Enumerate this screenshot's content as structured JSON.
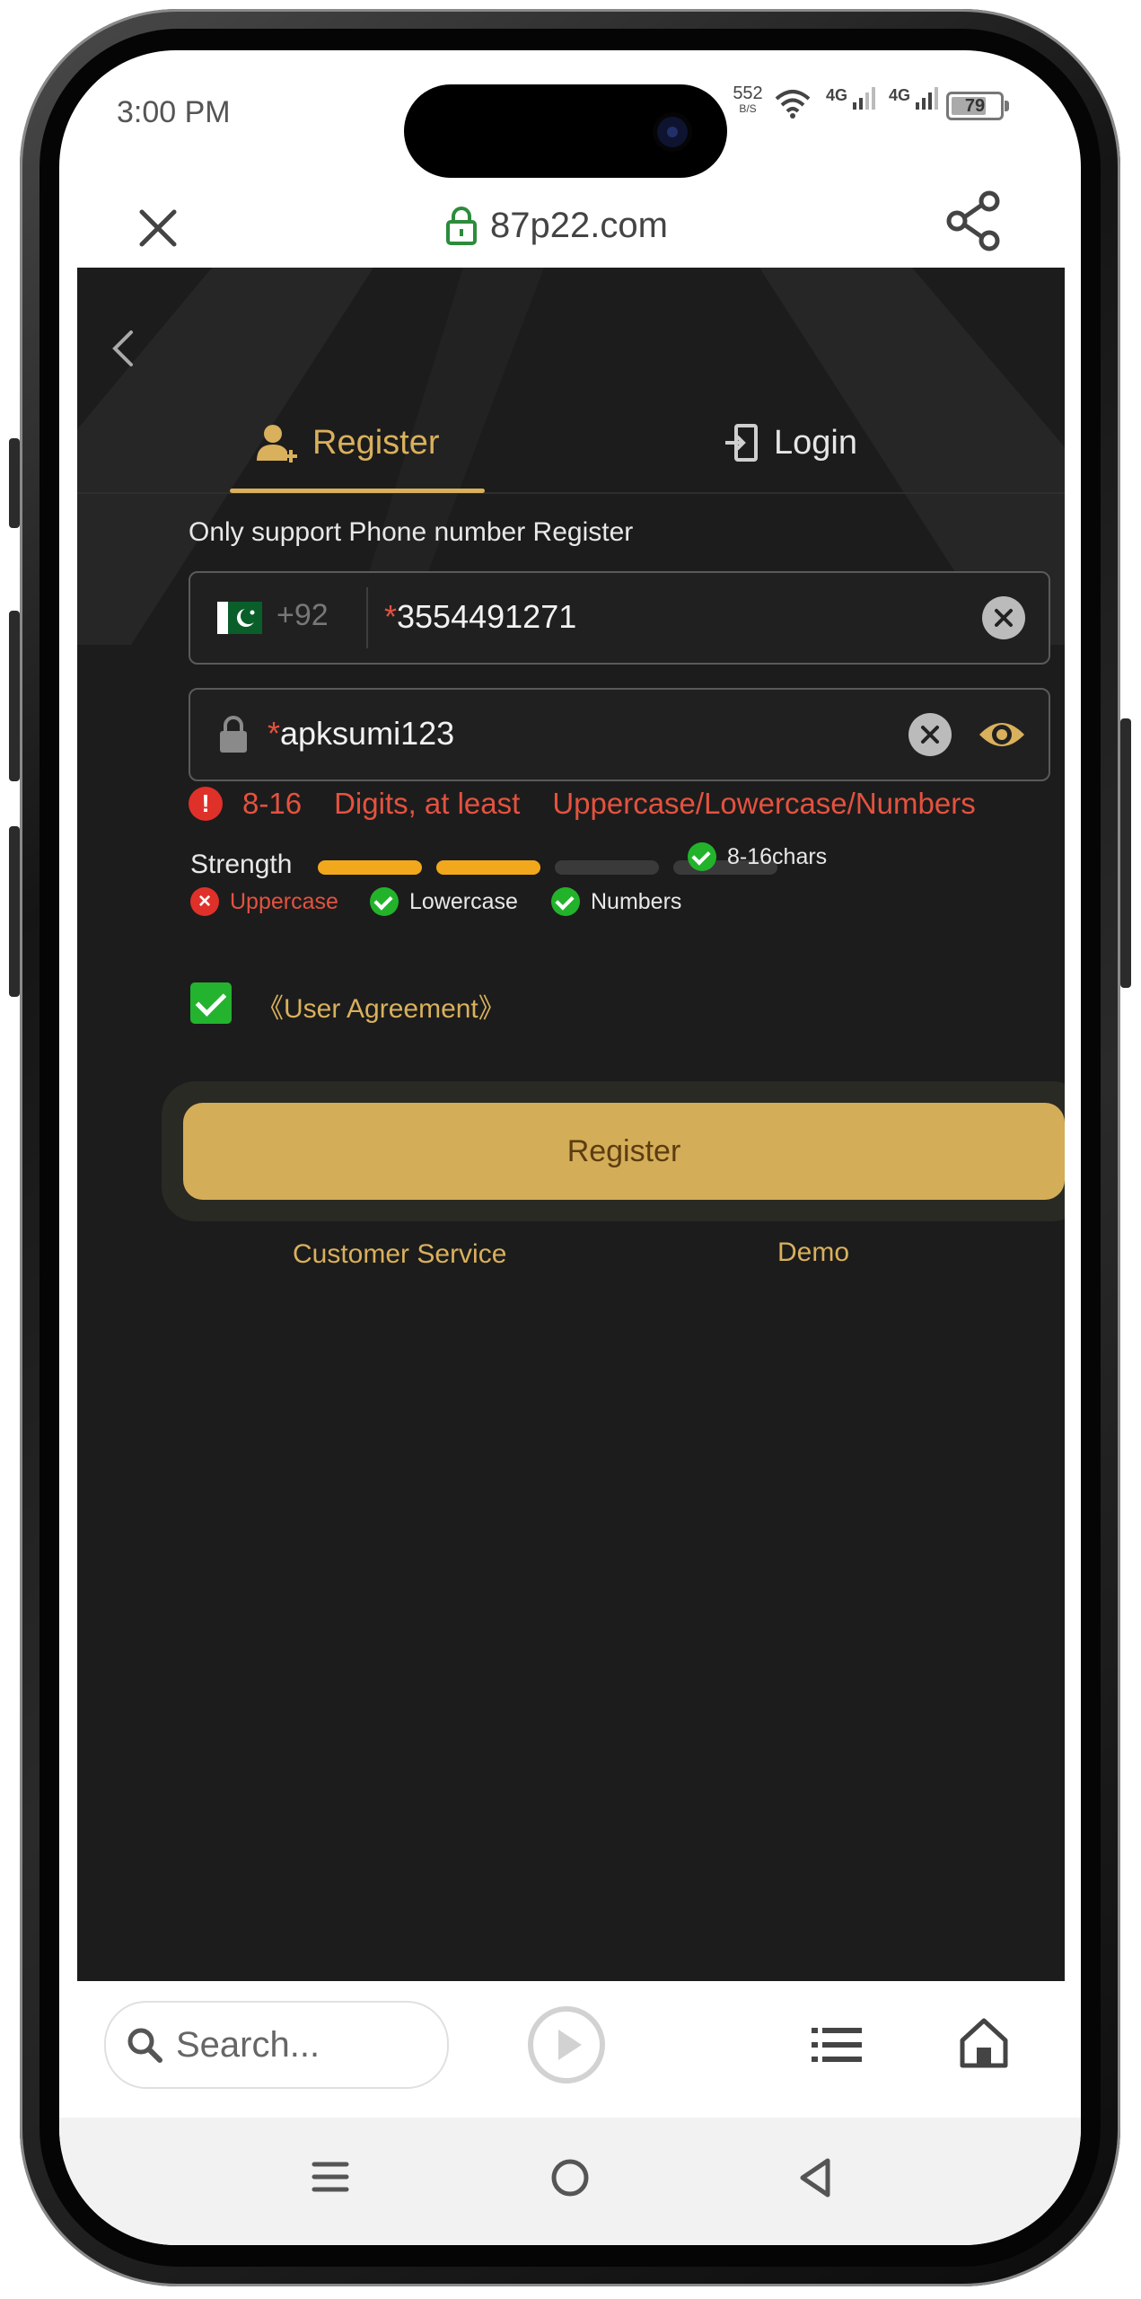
{
  "status_bar": {
    "time": "3:00 PM",
    "net_rate": "552",
    "net_rate_unit": "B/S",
    "signal1": "4G",
    "signal2": "4G",
    "battery": "79"
  },
  "browser": {
    "url": "87p22.com",
    "search_placeholder": "Search..."
  },
  "auth": {
    "tab_register": "Register",
    "tab_login": "Login",
    "hint": "Only support Phone number Register",
    "phone": {
      "country_code": "+92",
      "required_mark": "*",
      "value": "3554491271"
    },
    "password": {
      "required_mark": "*",
      "value": "apksumi123"
    },
    "error": {
      "part1": "8-16",
      "part2": "Digits, at least",
      "part3": "Uppercase/Lowercase/Numbers"
    },
    "strength": {
      "label": "Strength",
      "level": 2,
      "max": 4,
      "criteria": [
        {
          "label": "8-16chars",
          "met": true
        },
        {
          "label": "Uppercase",
          "met": false
        },
        {
          "label": "Lowercase",
          "met": true
        },
        {
          "label": "Numbers",
          "met": true
        }
      ]
    },
    "agreement": {
      "checked": true,
      "label": "《User Agreement》"
    },
    "register_button": "Register",
    "customer_service": "Customer Service",
    "demo": "Demo"
  },
  "colors": {
    "accent": "#d9b05c",
    "button": "#d4ad58",
    "background": "#1c1c1c",
    "error": "#e4523f",
    "ok": "#22b32b",
    "bar_on": "#f2a81c"
  }
}
